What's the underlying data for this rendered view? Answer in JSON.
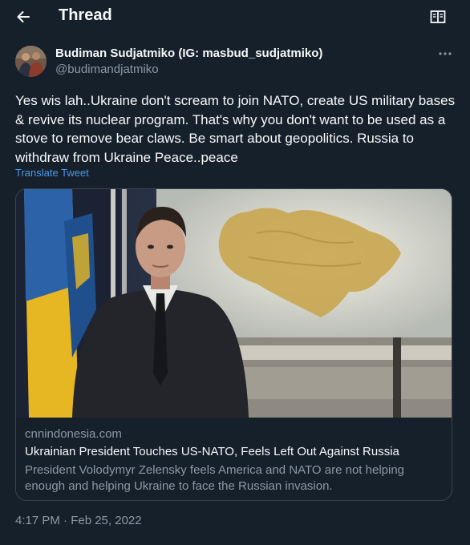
{
  "header": {
    "title": "Thread",
    "back_icon": "arrow-left-icon",
    "reader_icon": "book-open-icon"
  },
  "tweet": {
    "author_name": "Budiman Sudjatmiko (IG: masbud_sudjatmiko)",
    "author_handle": "@budimandjatmiko",
    "more_icon": "ellipsis-icon",
    "text": "Yes wis lah..Ukraine don't scream to join NATO, create US military bases & revive its nuclear program. That's why you don't want to be used as a stove to remove bear claws. Be smart about geopolitics. Russia to withdraw from Ukraine Peace..peace",
    "translate_label": "Translate Tweet",
    "timestamp": "4:17 PM · Feb 25, 2022"
  },
  "card": {
    "domain": "cnnindonesia.com",
    "title": "Ukrainian President Touches US-NATO, Feels Left Out Against Russia",
    "description": "President Volodymyr Zelensky feels America and NATO are not helping enough and helping Ukraine to face the Russian invasion."
  },
  "colors": {
    "background": "#15202b",
    "text_primary": "#f7f9f9",
    "text_secondary": "#8b98a5",
    "link": "#4a99e9",
    "border": "#38444d"
  }
}
